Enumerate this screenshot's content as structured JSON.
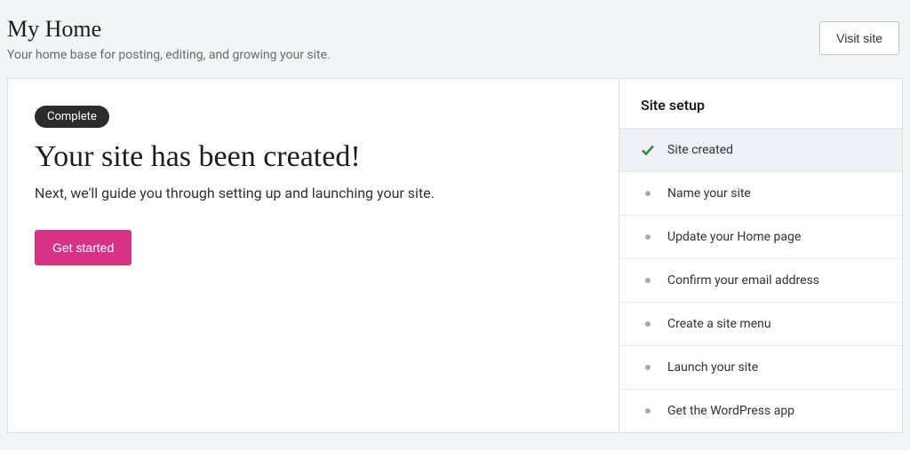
{
  "header": {
    "title": "My Home",
    "subtitle": "Your home base for posting, editing, and growing your site.",
    "visit_site": "Visit site"
  },
  "hero": {
    "badge": "Complete",
    "title": "Your site has been created!",
    "subtitle": "Next, we'll guide you through setting up and launching your site.",
    "cta": "Get started"
  },
  "setup": {
    "title": "Site setup",
    "steps": [
      {
        "label": "Site created",
        "done": true
      },
      {
        "label": "Name your site",
        "done": false
      },
      {
        "label": "Update your Home page",
        "done": false
      },
      {
        "label": "Confirm your email address",
        "done": false
      },
      {
        "label": "Create a site menu",
        "done": false
      },
      {
        "label": "Launch your site",
        "done": false
      },
      {
        "label": "Get the WordPress app",
        "done": false
      }
    ]
  }
}
